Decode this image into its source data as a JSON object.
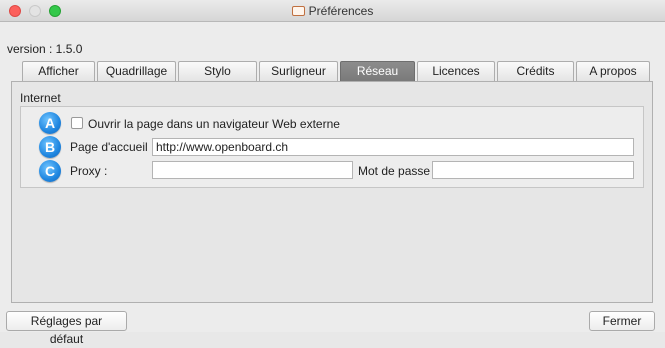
{
  "window": {
    "title": "Préférences"
  },
  "version_label": "version : 1.5.0",
  "tabs": [
    {
      "label": "Afficher",
      "active": false
    },
    {
      "label": "Quadrillage",
      "active": false
    },
    {
      "label": "Stylo",
      "active": false
    },
    {
      "label": "Surligneur",
      "active": false
    },
    {
      "label": "Réseau",
      "active": true
    },
    {
      "label": "Licences",
      "active": false
    },
    {
      "label": "Crédits",
      "active": false
    },
    {
      "label": "A propos",
      "active": false
    }
  ],
  "internet": {
    "group_title": "Internet",
    "badges": [
      "A",
      "B",
      "C"
    ],
    "open_external_label": "Ouvrir la page dans un navigateur Web externe",
    "open_external_checked": false,
    "homepage_label": "Page d'accueil :",
    "homepage_value": "http://www.openboard.ch",
    "proxy_label": "Proxy :",
    "proxy_value": "",
    "password_label": "Mot de passe :",
    "password_value": ""
  },
  "buttons": {
    "defaults_label": "Réglages par défaut",
    "close_label": "Fermer"
  },
  "colors": {
    "active_tab": "#7f7f7f",
    "badge_blue": "#1f86e0",
    "close_red": "#fc605c",
    "zoom_green": "#34c84a"
  }
}
